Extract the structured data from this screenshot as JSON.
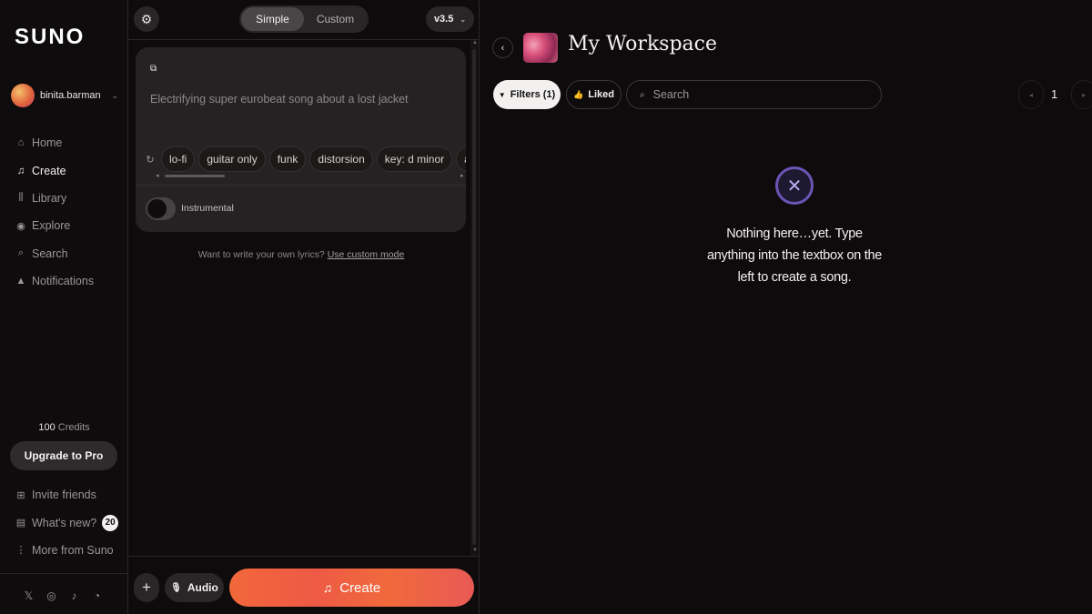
{
  "sidebar": {
    "logo": "SUNO",
    "user": {
      "name": "binita.barman"
    },
    "nav": [
      {
        "id": "home",
        "label": "Home",
        "icon": "home-icon",
        "glyph": "⌂"
      },
      {
        "id": "create",
        "label": "Create",
        "icon": "music-note-icon",
        "glyph": "♫"
      },
      {
        "id": "library",
        "label": "Library",
        "icon": "library-icon",
        "glyph": "⫼"
      },
      {
        "id": "explore",
        "label": "Explore",
        "icon": "compass-icon",
        "glyph": "◉"
      },
      {
        "id": "search",
        "label": "Search",
        "icon": "search-icon",
        "glyph": "⌕"
      },
      {
        "id": "notifications",
        "label": "Notifications",
        "icon": "bell-icon",
        "glyph": "▲"
      }
    ],
    "active_nav": "create",
    "credits_value": "100",
    "credits_label": "Credits",
    "upgrade_label": "Upgrade to Pro",
    "bottom_nav": [
      {
        "label": "Invite friends",
        "icon": "gift-icon",
        "glyph": "⊞"
      },
      {
        "label": "What's new?",
        "icon": "document-icon",
        "glyph": "▤",
        "badge": "20"
      },
      {
        "label": "More from Suno",
        "icon": "more-vertical-icon",
        "glyph": "⋮"
      }
    ],
    "social": [
      {
        "icon": "x-twitter-icon",
        "glyph": "𝕏"
      },
      {
        "icon": "instagram-icon",
        "glyph": "◎"
      },
      {
        "icon": "tiktok-icon",
        "glyph": "♪"
      },
      {
        "icon": "discord-icon",
        "glyph": "◔"
      }
    ]
  },
  "composer": {
    "modes": [
      "Simple",
      "Custom"
    ],
    "active_mode": "Simple",
    "version": "v3.5",
    "prompt_placeholder": "Electrifying super eurobeat song about a lost jacket",
    "tags": [
      "lo-fi",
      "guitar only",
      "funk",
      "distorsion",
      "key: d minor",
      "alternativ"
    ],
    "instrumental_label": "Instrumental",
    "instrumental_on": false,
    "lyrics_hint": "Want to write your own lyrics?",
    "lyrics_link": "Use custom mode",
    "plus_label": "+",
    "audio_label": "Audio",
    "create_label": "Create"
  },
  "workspace": {
    "title": "My Workspace",
    "filters_label": "Filters (1)",
    "liked_label": "Liked",
    "search_placeholder": "Search",
    "page": "1",
    "empty_message": "Nothing here…yet. Type anything into the textbox on the left to create a song."
  },
  "colors": {
    "background": "#0d0b0c",
    "accent_gradient_start": "#f2673b",
    "accent_gradient_end": "#e75a55",
    "empty_icon": "#6b55b5"
  }
}
